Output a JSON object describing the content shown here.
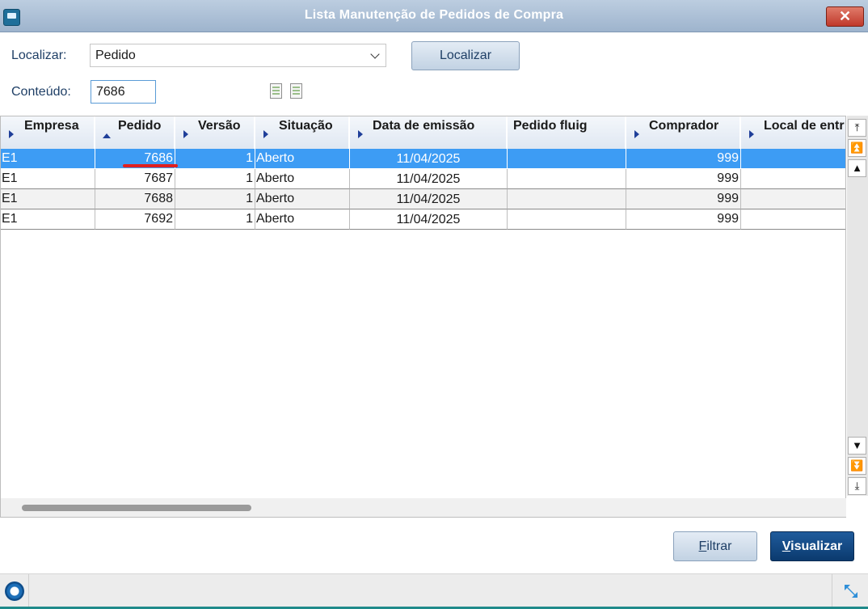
{
  "window": {
    "title": "Lista Manutenção de Pedidos de Compra",
    "close_label": "✕"
  },
  "search": {
    "localizar_label": "Localizar:",
    "localizar_value": "Pedido",
    "localizar_button": "Localizar",
    "conteudo_label": "Conteúdo:",
    "conteudo_value": "7686"
  },
  "grid": {
    "columns": [
      "Empresa",
      "Pedido",
      "Versão",
      "Situação",
      "Data de emissão",
      "Pedido fluig",
      "Comprador",
      "Local de entr"
    ],
    "sorted_column": "Pedido",
    "rows": [
      {
        "empresa": "E1",
        "pedido": "7686",
        "versao": "1",
        "situacao": "Aberto",
        "data": "11/04/2025",
        "fluig": "",
        "comprador": "999",
        "local": "",
        "selected": true
      },
      {
        "empresa": "E1",
        "pedido": "7687",
        "versao": "1",
        "situacao": "Aberto",
        "data": "11/04/2025",
        "fluig": "",
        "comprador": "999",
        "local": ""
      },
      {
        "empresa": "E1",
        "pedido": "7688",
        "versao": "1",
        "situacao": "Aberto",
        "data": "11/04/2025",
        "fluig": "",
        "comprador": "999",
        "local": ""
      },
      {
        "empresa": "E1",
        "pedido": "7692",
        "versao": "1",
        "situacao": "Aberto",
        "data": "11/04/2025",
        "fluig": "",
        "comprador": "999",
        "local": ""
      }
    ]
  },
  "footer": {
    "filtrar_label": "Filtrar",
    "visualizar_label": "Visualizar"
  },
  "colors": {
    "selected_row": "#3d9cf4",
    "annotation_mark": "#e02020",
    "primary_button": "#0b3a6e"
  },
  "icons": [
    "app-window-icon",
    "close-icon",
    "chevron-down-icon",
    "document-icon",
    "sort-arrow-icon",
    "scroll-top-icon",
    "scroll-page-up-icon",
    "scroll-up-icon",
    "scroll-down-icon",
    "scroll-page-down-icon",
    "scroll-bottom-icon",
    "app-logo-icon",
    "resize-icon"
  ]
}
